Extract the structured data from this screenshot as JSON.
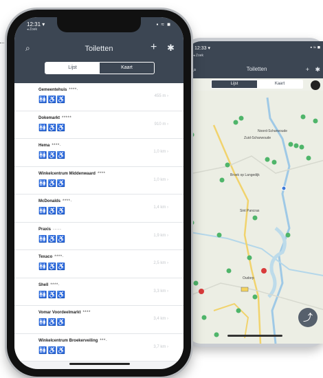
{
  "list_phone": {
    "status": {
      "time": "12:31 ▾",
      "sub": "◂ Zoek",
      "signal": "▪ ≈ ■"
    },
    "nav": {
      "title": "Toiletten",
      "search_icon": "search-icon",
      "add_icon": "plus-icon",
      "settings_icon": "gear-icon"
    },
    "segments": [
      {
        "label": "Lijst",
        "active": true
      },
      {
        "label": "Kaart",
        "active": false
      }
    ],
    "rows": [
      {
        "name": "Gemeentehuis",
        "stars": "****·",
        "distance": "455 m  ›"
      },
      {
        "name": "Dokemarkt",
        "stars": "*****",
        "distance": "910 m  ›"
      },
      {
        "name": "Hema",
        "stars": "****·",
        "distance": "1,0 km  ›"
      },
      {
        "name": "Winkelcentrum Middenwaard",
        "stars": "****",
        "distance": "1,0 km  ›"
      },
      {
        "name": "McDonalds",
        "stars": "****·",
        "distance": "1,4 km  ›"
      },
      {
        "name": "Praxis",
        "stars": "·····",
        "distance": "1,9 km  ›"
      },
      {
        "name": "Texaco",
        "stars": "****·",
        "distance": "2,5 km  ›"
      },
      {
        "name": "Shell",
        "stars": "****·",
        "distance": "3,3 km  ›"
      },
      {
        "name": "Vomar Voordeelmarkt",
        "stars": "****",
        "distance": "3,4 km  ›"
      },
      {
        "name": "Winkelcentrum Broekerveiling",
        "stars": "***·",
        "distance": "3,7 km  ›"
      }
    ]
  },
  "map_phone": {
    "status": {
      "time": "12:33 ▾",
      "sub": "◂ Zoek",
      "signal": "▪ ≈ ■"
    },
    "nav": {
      "title": "Toiletten"
    },
    "segments": [
      {
        "label": "Lijst",
        "active": false
      },
      {
        "label": "Kaart",
        "active": true
      }
    ],
    "labels": [
      "Zuid-Scharwoude",
      "Broek op Langedijk",
      "Sint Pancras",
      "Oudorp",
      "Noord-Scharwoude"
    ],
    "share_icon": "share-icon"
  }
}
